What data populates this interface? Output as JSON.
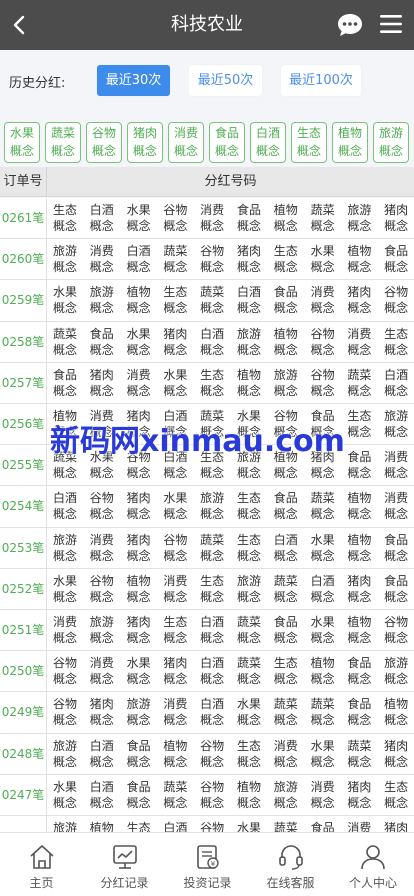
{
  "header": {
    "title": "科技农业"
  },
  "filter": {
    "label": "历史分红:",
    "buttons": [
      {
        "label": "最近30次",
        "active": true
      },
      {
        "label": "最近50次",
        "active": false
      },
      {
        "label": "最近100次",
        "active": false
      }
    ]
  },
  "categories": [
    [
      "水果",
      "概念"
    ],
    [
      "蔬菜",
      "概念"
    ],
    [
      "谷物",
      "概念"
    ],
    [
      "猪肉",
      "概念"
    ],
    [
      "消费",
      "概念"
    ],
    [
      "食品",
      "概念"
    ],
    [
      "白酒",
      "概念"
    ],
    [
      "生态",
      "概念"
    ],
    [
      "植物",
      "概念"
    ],
    [
      "旅游",
      "概念"
    ]
  ],
  "table": {
    "col_order": "订单号",
    "col_codes": "分红号码",
    "code_suffix": "概念",
    "rows": [
      {
        "id": "0261笔",
        "codes": [
          "生态",
          "白酒",
          "水果",
          "谷物",
          "消费",
          "食品",
          "植物",
          "蔬菜",
          "旅游",
          "猪肉"
        ]
      },
      {
        "id": "0260笔",
        "codes": [
          "旅游",
          "消费",
          "白酒",
          "蔬菜",
          "谷物",
          "猪肉",
          "生态",
          "水果",
          "植物",
          "食品"
        ]
      },
      {
        "id": "0259笔",
        "codes": [
          "水果",
          "旅游",
          "植物",
          "生态",
          "蔬菜",
          "白酒",
          "食品",
          "消费",
          "猪肉",
          "谷物"
        ]
      },
      {
        "id": "0258笔",
        "codes": [
          "蔬菜",
          "食品",
          "水果",
          "猪肉",
          "白酒",
          "旅游",
          "植物",
          "谷物",
          "消费",
          "生态"
        ]
      },
      {
        "id": "0257笔",
        "codes": [
          "食品",
          "猪肉",
          "消费",
          "水果",
          "生态",
          "植物",
          "旅游",
          "谷物",
          "蔬菜",
          "白酒"
        ]
      },
      {
        "id": "0256笔",
        "codes": [
          "植物",
          "消费",
          "猪肉",
          "白酒",
          "蔬菜",
          "水果",
          "谷物",
          "食品",
          "生态",
          "旅游"
        ]
      },
      {
        "id": "0255笔",
        "codes": [
          "蔬菜",
          "水果",
          "谷物",
          "白酒",
          "生态",
          "旅游",
          "植物",
          "猪肉",
          "食品",
          "消费"
        ]
      },
      {
        "id": "0254笔",
        "codes": [
          "白酒",
          "谷物",
          "猪肉",
          "水果",
          "旅游",
          "生态",
          "食品",
          "蔬菜",
          "植物",
          "消费"
        ]
      },
      {
        "id": "0253笔",
        "codes": [
          "旅游",
          "消费",
          "猪肉",
          "谷物",
          "蔬菜",
          "生态",
          "白酒",
          "水果",
          "植物",
          "食品"
        ]
      },
      {
        "id": "0252笔",
        "codes": [
          "水果",
          "谷物",
          "植物",
          "消费",
          "生态",
          "旅游",
          "蔬菜",
          "白酒",
          "猪肉",
          "食品"
        ]
      },
      {
        "id": "0251笔",
        "codes": [
          "消费",
          "旅游",
          "猪肉",
          "生态",
          "白酒",
          "蔬菜",
          "食品",
          "水果",
          "植物",
          "谷物"
        ]
      },
      {
        "id": "0250笔",
        "codes": [
          "谷物",
          "消费",
          "水果",
          "猪肉",
          "白酒",
          "蔬菜",
          "生态",
          "植物",
          "食品",
          "旅游"
        ]
      },
      {
        "id": "0249笔",
        "codes": [
          "谷物",
          "猪肉",
          "旅游",
          "消费",
          "白酒",
          "水果",
          "蔬菜",
          "蔬菜",
          "食品",
          "植物"
        ]
      },
      {
        "id": "0248笔",
        "codes": [
          "旅游",
          "白酒",
          "食品",
          "植物",
          "谷物",
          "生态",
          "消费",
          "水果",
          "蔬菜",
          "猪肉"
        ]
      },
      {
        "id": "0247笔",
        "codes": [
          "水果",
          "白酒",
          "食品",
          "蔬菜",
          "谷物",
          "植物",
          "旅游",
          "消费",
          "猪肉",
          "生态"
        ]
      },
      {
        "id": "",
        "codes": [
          "旅游",
          "植物",
          "生态",
          "白酒",
          "谷物",
          "水果",
          "蔬菜",
          "食品",
          "消费",
          "猪肉"
        ]
      }
    ]
  },
  "watermark": "新码网xinmau.com",
  "tabs": [
    {
      "label": "主页",
      "icon": "home-icon"
    },
    {
      "label": "分红记录",
      "icon": "chart-icon"
    },
    {
      "label": "投资记录",
      "icon": "document-icon"
    },
    {
      "label": "在线客服",
      "icon": "headset-icon"
    },
    {
      "label": "个人中心",
      "icon": "user-icon"
    }
  ],
  "colors": {
    "header_bg": "#4c4c4c",
    "accent_blue": "#3d8bea",
    "accent_green": "#4fae52"
  }
}
